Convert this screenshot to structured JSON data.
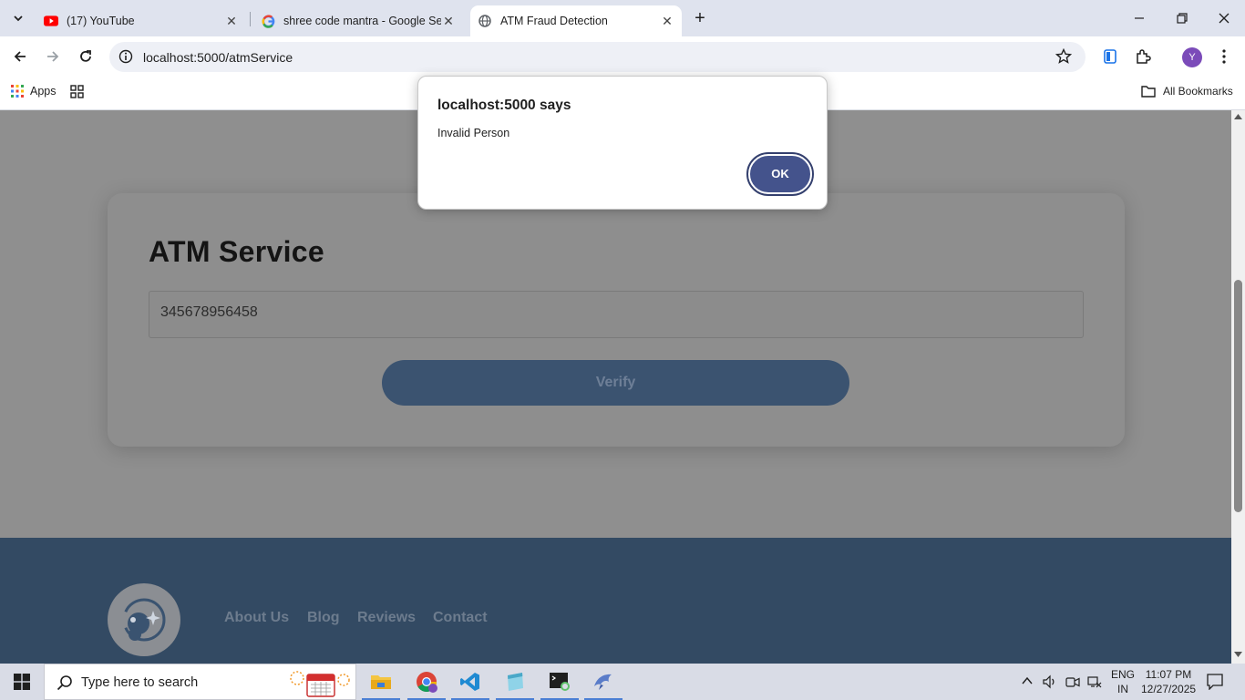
{
  "browser": {
    "tabs": [
      {
        "title": "(17) YouTube",
        "icon": "youtube-icon",
        "active": false
      },
      {
        "title": "shree code mantra - Google Se",
        "icon": "google-icon",
        "active": false
      },
      {
        "title": "ATM Fraud Detection",
        "icon": "globe-icon",
        "active": true
      }
    ],
    "url": "localhost:5000/atmService",
    "profile_initial": "Y",
    "bookmarks": {
      "apps_label": "Apps",
      "all_bookmarks_label": "All Bookmarks"
    }
  },
  "page": {
    "card_title": "ATM Service",
    "atm_input_value": "345678956458",
    "verify_label": "Verify",
    "footer_links": [
      "About Us",
      "Blog",
      "Reviews",
      "Contact"
    ]
  },
  "dialog": {
    "title": "localhost:5000 says",
    "message": "Invalid Person",
    "ok_label": "OK"
  },
  "taskbar": {
    "search_placeholder": "Type here to search",
    "lang_top": "ENG",
    "lang_bottom": "IN",
    "time": "11:07 PM",
    "date": "12/27/2025"
  },
  "colors": {
    "accent": "#44538c",
    "footer": "#334a63",
    "verify_button": "#3b5370"
  }
}
